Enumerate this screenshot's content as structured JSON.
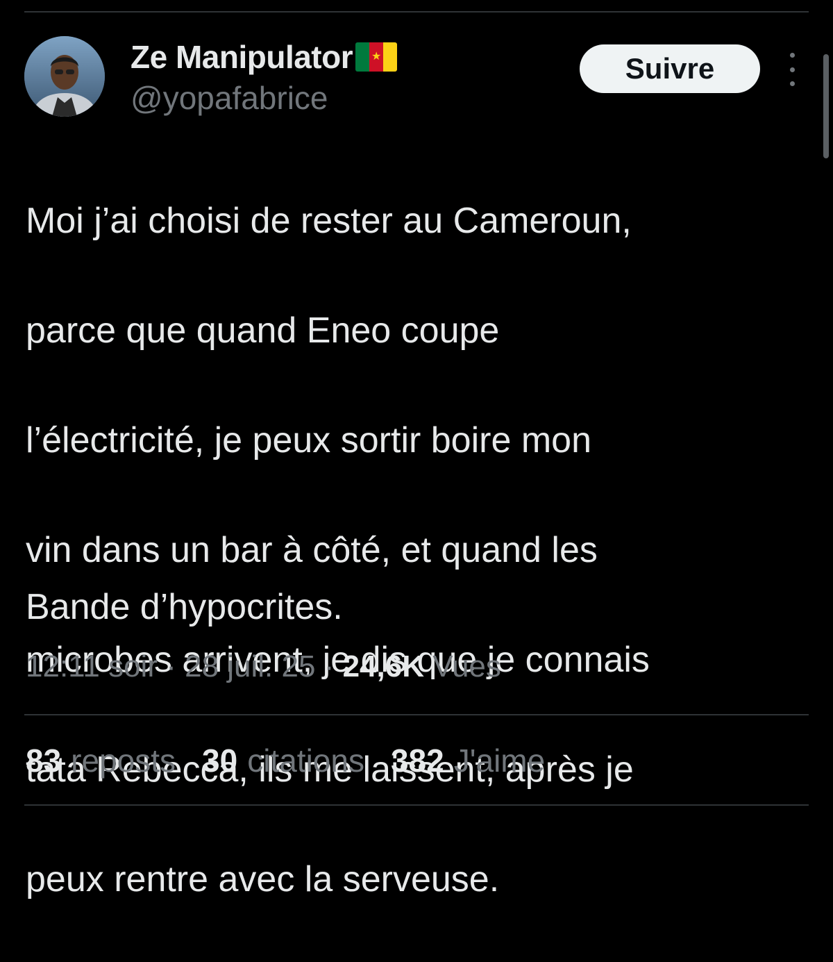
{
  "author": {
    "display_name": "Ze Manipulator",
    "flag_icon": "cameroon-flag-icon",
    "handle": "@yopafabrice"
  },
  "follow_button_label": "Suivre",
  "more_icon": "more-vertical-icon",
  "tweet": {
    "lines": [
      "Moi j’ai choisi de rester au Cameroun,",
      "parce que quand Eneo coupe",
      "l’électricité, je peux sortir boire mon",
      "vin dans un bar à côté, et quand les",
      "microbes arrivent, je dis que je connais",
      "tata Rebecca, ils me laissent, après je",
      "peux rentre avec la serveuse."
    ],
    "closing": "Bande d’hypocrites."
  },
  "meta": {
    "time": "12:11 soir",
    "separator": "·",
    "date": "28 juil. 25",
    "views_count": "24,6K",
    "views_label": "Vues"
  },
  "stats": [
    {
      "count": "83",
      "label": "reposts"
    },
    {
      "count": "30",
      "label": "citations"
    },
    {
      "count": "382",
      "label": "J'aime"
    }
  ],
  "colors": {
    "background": "#000000",
    "text_primary": "#e7e9ea",
    "text_secondary": "#71767b",
    "divider": "#2f3336",
    "follow_button_bg": "#eff3f4"
  }
}
